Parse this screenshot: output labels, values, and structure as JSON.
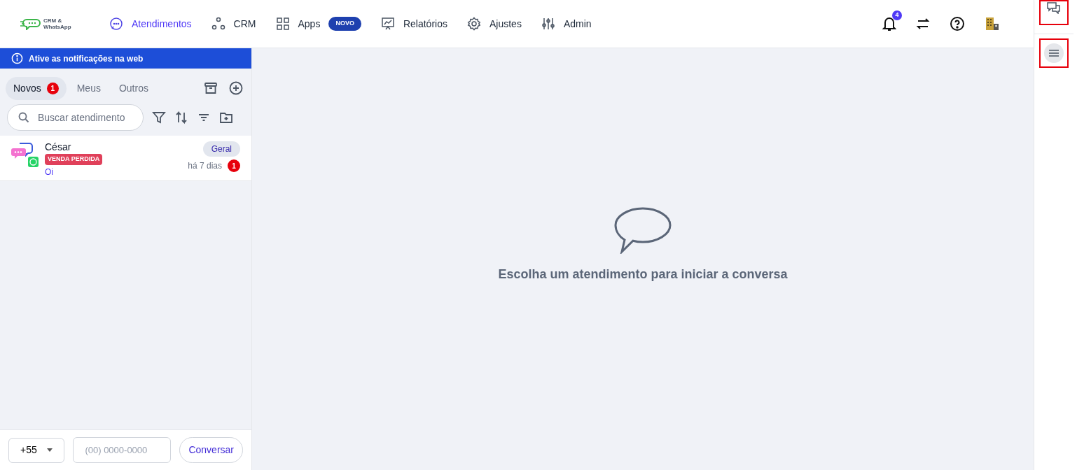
{
  "logo": {
    "text": "CRM & WhatsApp"
  },
  "nav": [
    {
      "label": "Atendimentos",
      "selected": true
    },
    {
      "label": "CRM",
      "selected": false
    },
    {
      "label": "Apps",
      "selected": false,
      "badge": "NOVO"
    },
    {
      "label": "Relatórios",
      "selected": false
    },
    {
      "label": "Ajustes",
      "selected": false
    },
    {
      "label": "Admin",
      "selected": false
    }
  ],
  "notifications_count": "4",
  "banner": "Ative as notificações na web",
  "tabs": [
    {
      "label": "Novos",
      "selected": true,
      "count": "1"
    },
    {
      "label": "Meus",
      "selected": false
    },
    {
      "label": "Outros",
      "selected": false
    }
  ],
  "search": {
    "placeholder": "Buscar atendimento"
  },
  "conversations": [
    {
      "name": "César",
      "tag": "VENDA PERDIDA",
      "color": "#e0405a",
      "message": "Oi",
      "queue": "Geral",
      "time": "há 7 dias",
      "unread": "1"
    }
  ],
  "empty_state": "Escolha um atendimento para iniciar a conversa",
  "footer": {
    "country_code": "+55",
    "phone_placeholder": "(00) 0000-0000",
    "button": "Conversar"
  }
}
